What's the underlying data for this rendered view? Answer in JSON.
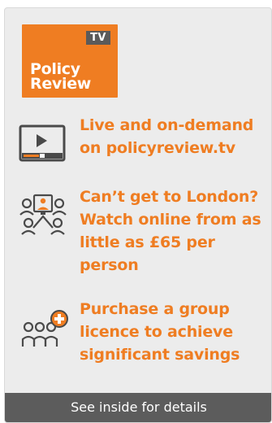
{
  "logo": {
    "badge": "TV",
    "line1": "Policy",
    "line2": "Review",
    "color": "#ef7d22"
  },
  "features": [
    {
      "icon": "video-player-icon",
      "text": "Live and on-demand on policyreview.tv"
    },
    {
      "icon": "online-audience-icon",
      "text": "Can’t get to London? Watch online from as little as £65 per person"
    },
    {
      "icon": "group-add-icon",
      "text": "Purchase a group licence to achieve significant savings"
    }
  ],
  "footer": {
    "label": "See inside for details"
  },
  "colors": {
    "accent": "#ef7d22",
    "panel": "#ececec",
    "footer": "#5c5c5c"
  }
}
